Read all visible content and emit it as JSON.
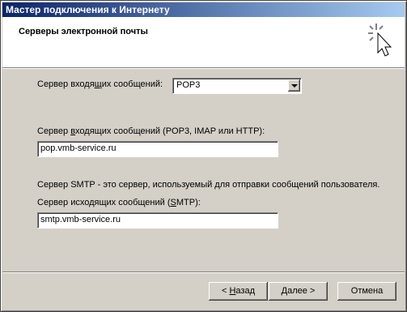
{
  "window": {
    "title": "Мастер подключения к Интернету"
  },
  "header": {
    "title": "Серверы электронной почты",
    "icon": "wizard-sparkle-cursor-icon"
  },
  "incoming_type": {
    "label_pre": "Сервер входя",
    "label_accel": "щ",
    "label_post": "их сообщений:",
    "value": "POP3"
  },
  "incoming_server": {
    "label_pre": "Сервер ",
    "label_accel": "в",
    "label_post": "ходящих сообщений (POP3, IMAP или HTTP):",
    "value": "pop.vmb-service.ru"
  },
  "smtp_info": "Сервер SMTP - это сервер, используемый для отправки сообщений  пользователя.",
  "outgoing_server": {
    "label_pre": "Сервер исходящих сообщений (",
    "label_accel": "S",
    "label_post": "MTP):",
    "value": "smtp.vmb-service.ru"
  },
  "buttons": {
    "back_pre": "< ",
    "back_accel": "Н",
    "back_post": "азад",
    "next": "Далее >",
    "cancel": "Отмена"
  }
}
